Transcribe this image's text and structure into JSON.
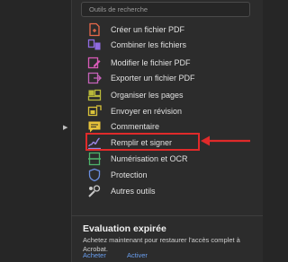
{
  "search": {
    "placeholder": "Outils de recherche"
  },
  "tools": [
    {
      "label": "Créer un fichier PDF",
      "icon": "create-pdf-icon",
      "color": "#e8694a"
    },
    {
      "label": "Combiner les fichiers",
      "icon": "combine-files-icon",
      "color": "#8f6be0"
    },
    {
      "label": "Modifier le fichier PDF",
      "icon": "edit-pdf-icon",
      "color": "#d95bb8"
    },
    {
      "label": "Exporter un fichier PDF",
      "icon": "export-pdf-icon",
      "color": "#c462b8"
    },
    {
      "label": "Organiser les pages",
      "icon": "organize-pages-icon",
      "color": "#b8b83a"
    },
    {
      "label": "Envoyer en révision",
      "icon": "send-for-review-icon",
      "color": "#d9c23a"
    },
    {
      "label": "Commentaire",
      "icon": "comment-icon",
      "color": "#e6c23a"
    },
    {
      "label": "Remplir et signer",
      "icon": "fill-and-sign-icon",
      "color": "#9a86e0"
    },
    {
      "label": "Numérisation et OCR",
      "icon": "scan-ocr-icon",
      "color": "#4fb36b"
    },
    {
      "label": "Protection",
      "icon": "protect-icon",
      "color": "#6b8fe0"
    },
    {
      "label": "Autres outils",
      "icon": "more-tools-icon",
      "color": "#c8c8c8"
    }
  ],
  "highlight_color": "#e02a2a",
  "evaluation": {
    "title": "Evaluation expirée",
    "text": "Achetez maintenant pour restaurer l'accès complet à Acrobat.",
    "buy_label": "Acheter",
    "activate_label": "Activer",
    "link_color": "#6a9ff0"
  }
}
